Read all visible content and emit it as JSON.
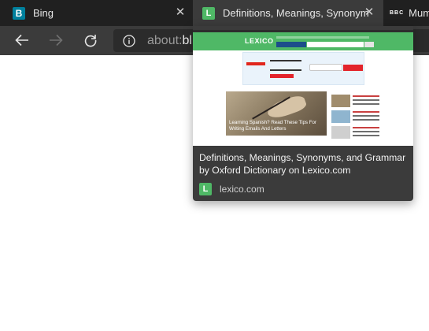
{
  "tabs": [
    {
      "label": "Bing",
      "favicon": "B",
      "icon": "bing-favicon"
    },
    {
      "label": "Definitions, Meanings, Synonyms",
      "favicon": "L",
      "icon": "lexico-favicon",
      "active": true
    },
    {
      "label": "Mum",
      "favicon": "BBC",
      "icon": "bbc-favicon"
    }
  ],
  "close_glyph": "✕",
  "toolbar": {
    "url_prefix": "about:",
    "url_strong": "bl"
  },
  "preview": {
    "title": "Definitions, Meanings, Synonyms, and Grammar by Oxford Dictionary on Lexico.com",
    "domain": "lexico.com",
    "favicon": "L",
    "thumbnail": {
      "logo": "LEXICO",
      "hero_caption": "Learning Spanish? Read These Tips For Writing Emails And Letters"
    }
  },
  "colors": {
    "tabstrip": "#202020",
    "toolbar": "#3b3b3b",
    "lexico_green": "#4fb866",
    "bing_teal": "#00809d"
  }
}
